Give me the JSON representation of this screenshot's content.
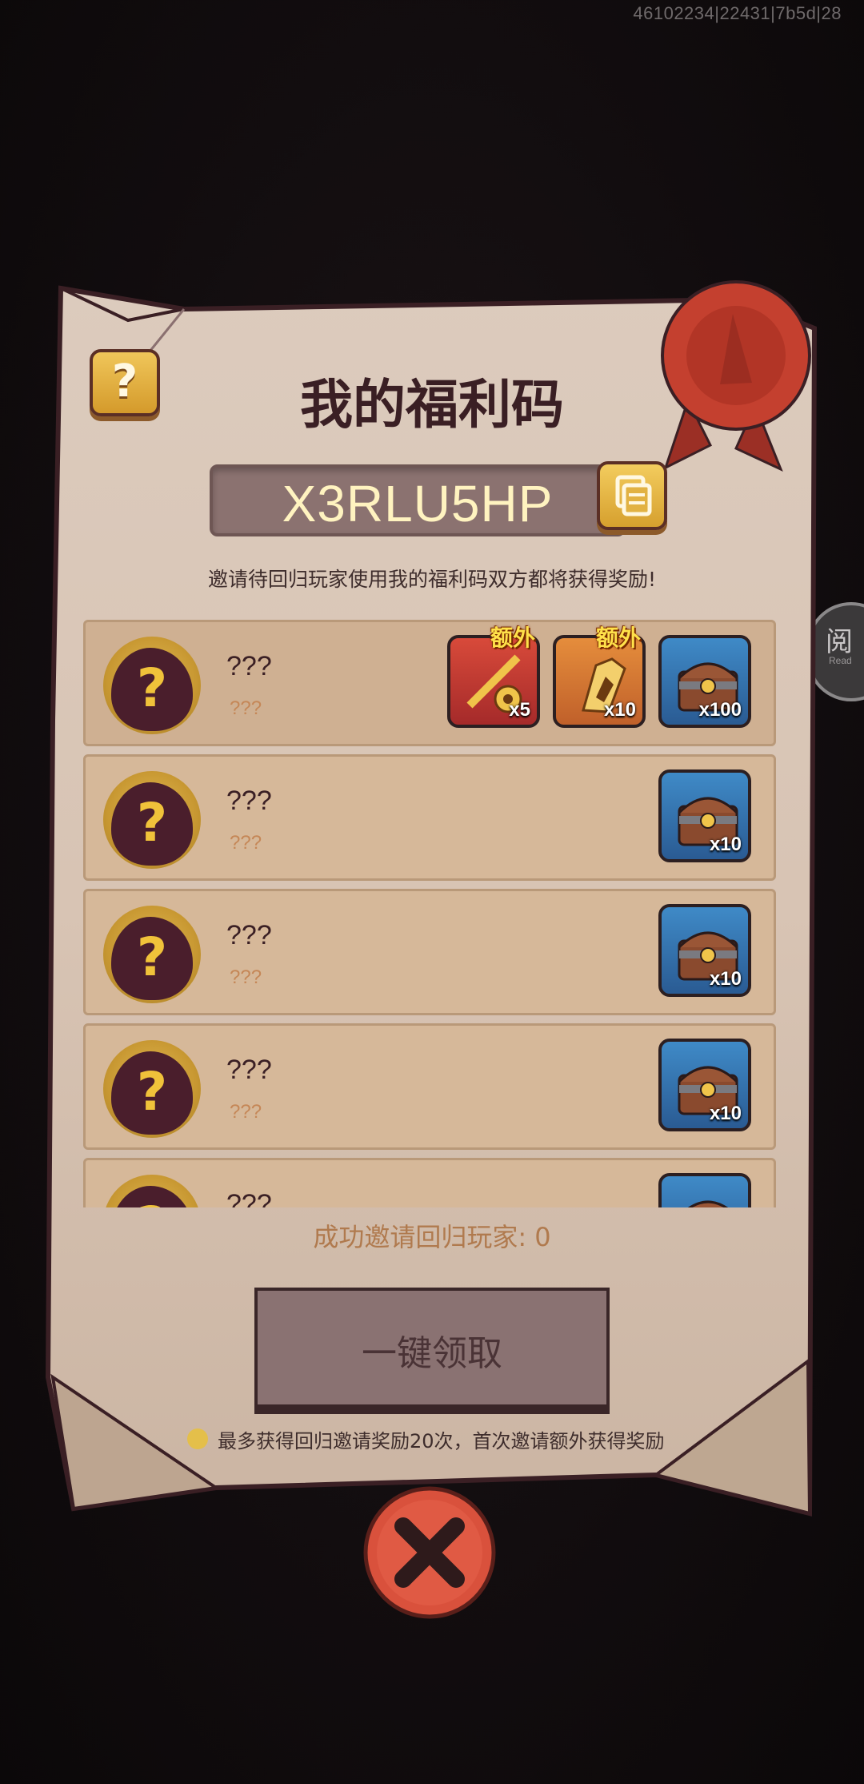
{
  "build_id": "46102234|22431|7b5d|28",
  "side_tab": {
    "label_cn": "阅",
    "label_en": "Read"
  },
  "title": "我的福利码",
  "code": "X3RLU5HP",
  "subtitle": "邀请待回归玩家使用我的福利码双方都将获得奖励!",
  "rows": [
    {
      "name": "???",
      "sub": "???",
      "rewards": [
        {
          "icon": "fishing-reel-icon",
          "qty": "x5",
          "tag": "额外"
        },
        {
          "icon": "bait-lure-icon",
          "qty": "x10",
          "tag": "额外"
        },
        {
          "icon": "treasure-chest-icon",
          "qty": "x100"
        }
      ]
    },
    {
      "name": "???",
      "sub": "???",
      "rewards": [
        {
          "icon": "treasure-chest-icon",
          "qty": "x10"
        }
      ]
    },
    {
      "name": "???",
      "sub": "???",
      "rewards": [
        {
          "icon": "treasure-chest-icon",
          "qty": "x10"
        }
      ]
    },
    {
      "name": "???",
      "sub": "???",
      "rewards": [
        {
          "icon": "treasure-chest-icon",
          "qty": "x10"
        }
      ]
    },
    {
      "name": "???",
      "sub": "???",
      "rewards": [
        {
          "icon": "treasure-chest-icon",
          "qty": ""
        }
      ]
    }
  ],
  "invite_count": "成功邀请回归玩家: 0",
  "claim_button": "一键领取",
  "note": "最多获得回归邀请奖励20次，首次邀请额外获得奖励",
  "colors": {
    "parchment": "#d9c6b6",
    "accent_gold": "#e0ad3a",
    "close_red": "#d9513c"
  }
}
